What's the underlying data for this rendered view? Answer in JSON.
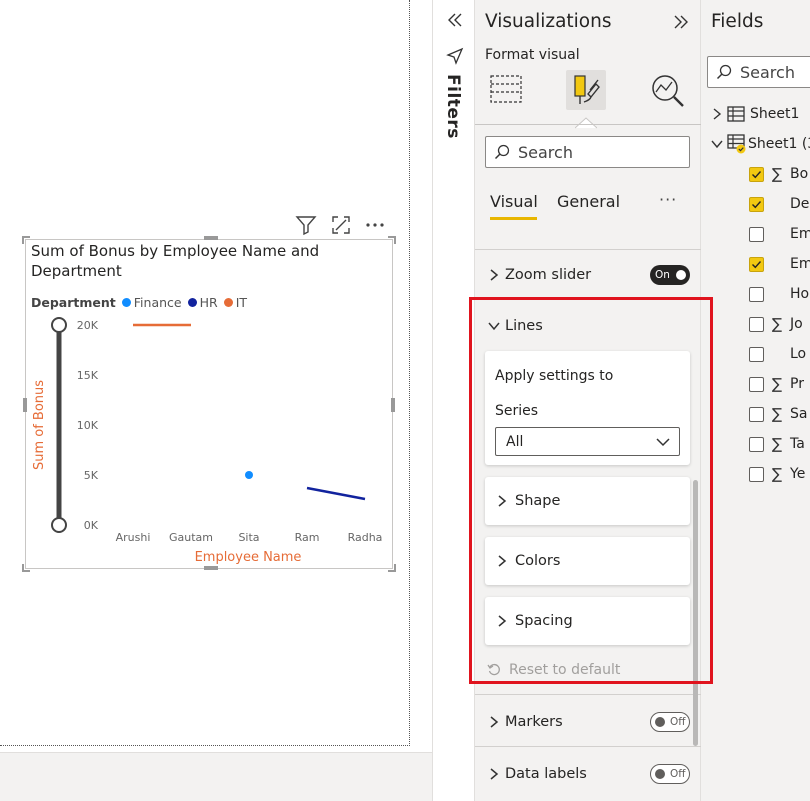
{
  "visual": {
    "title": "Sum of Bonus by Employee Name and Department",
    "legend": {
      "title": "Department",
      "items": [
        {
          "label": "Finance",
          "color": "#118dff"
        },
        {
          "label": "HR",
          "color": "#12239e"
        },
        {
          "label": "IT",
          "color": "#e66c37"
        }
      ]
    }
  },
  "chart_data": {
    "type": "line",
    "title": "Sum of Bonus by Employee Name and Department",
    "xlabel": "Employee Name",
    "ylabel": "Sum of Bonus",
    "categories": [
      "Arushi",
      "Gautam",
      "Sita",
      "Ram",
      "Radha"
    ],
    "y_ticks": [
      "0K",
      "5K",
      "10K",
      "15K",
      "20K"
    ],
    "ylim": [
      0,
      20000
    ],
    "series": [
      {
        "name": "Finance",
        "color": "#118dff",
        "values": [
          null,
          null,
          5000,
          null,
          null
        ]
      },
      {
        "name": "HR",
        "color": "#12239e",
        "values": [
          null,
          null,
          null,
          3700,
          2600
        ]
      },
      {
        "name": "IT",
        "color": "#e66c37",
        "values": [
          20000,
          20000,
          null,
          null,
          null
        ]
      }
    ],
    "axis_title_color": "#e66c37",
    "legend_position": "top-left",
    "zoom_slider": true
  },
  "filters": {
    "label": "Filters"
  },
  "viz_pane": {
    "title": "Visualizations",
    "subtitle": "Format visual",
    "search_placeholder": "Search",
    "tabs": [
      "Visual",
      "General"
    ],
    "more": "···",
    "zoom_slider": {
      "label": "Zoom slider",
      "toggle": "On"
    },
    "lines": {
      "label": "Lines",
      "apply_settings_to": "Apply settings to",
      "series_label": "Series",
      "series_value": "All",
      "sub_sections": [
        "Shape",
        "Colors",
        "Spacing"
      ],
      "reset": "Reset to default"
    },
    "markers": {
      "label": "Markers",
      "toggle": "Off"
    },
    "data_labels": {
      "label": "Data labels",
      "toggle": "Off"
    },
    "highlight_color": "#e0141e",
    "accent_color": "#e8b600"
  },
  "fields_pane": {
    "title": "Fields",
    "search_placeholder": "Search",
    "tables": [
      {
        "name": "Sheet1"
      },
      {
        "name": "Sheet1 (3"
      }
    ],
    "fields": [
      {
        "name": "Bo",
        "checked": true,
        "sigma": true
      },
      {
        "name": "De",
        "checked": true,
        "sigma": false
      },
      {
        "name": "Em",
        "checked": false,
        "sigma": false
      },
      {
        "name": "Em",
        "checked": true,
        "sigma": false
      },
      {
        "name": "Ho",
        "checked": false,
        "sigma": false
      },
      {
        "name": "Jo",
        "checked": false,
        "sigma": true
      },
      {
        "name": "Lo",
        "checked": false,
        "sigma": false
      },
      {
        "name": "Pr",
        "checked": false,
        "sigma": true
      },
      {
        "name": "Sa",
        "checked": false,
        "sigma": true
      },
      {
        "name": "Ta",
        "checked": false,
        "sigma": true
      },
      {
        "name": "Ye",
        "checked": false,
        "sigma": true
      }
    ]
  }
}
